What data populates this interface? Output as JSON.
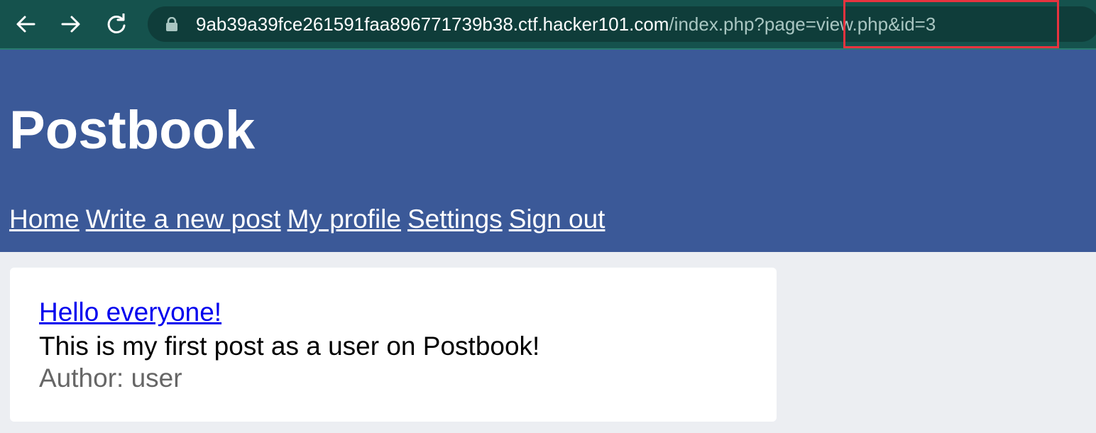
{
  "browser": {
    "url_host": "9ab39a39fce261591faa896771739b38.ctf.hacker101.com",
    "url_path": "/index.php?page=view.php&id=3",
    "icons": {
      "back": "arrow-left-icon",
      "forward": "arrow-right-icon",
      "reload": "reload-icon",
      "secure": "lock-icon"
    },
    "highlight_color": "#e8333f"
  },
  "site": {
    "title": "Postbook",
    "header_color": "#3b5998",
    "nav": {
      "home": "Home",
      "write_post": "Write a new post",
      "my_profile": "My profile",
      "settings": "Settings",
      "sign_out": "Sign out"
    }
  },
  "post": {
    "title": "Hello everyone!",
    "body": "This is my first post as a user on Postbook!",
    "author": "Author: user"
  }
}
